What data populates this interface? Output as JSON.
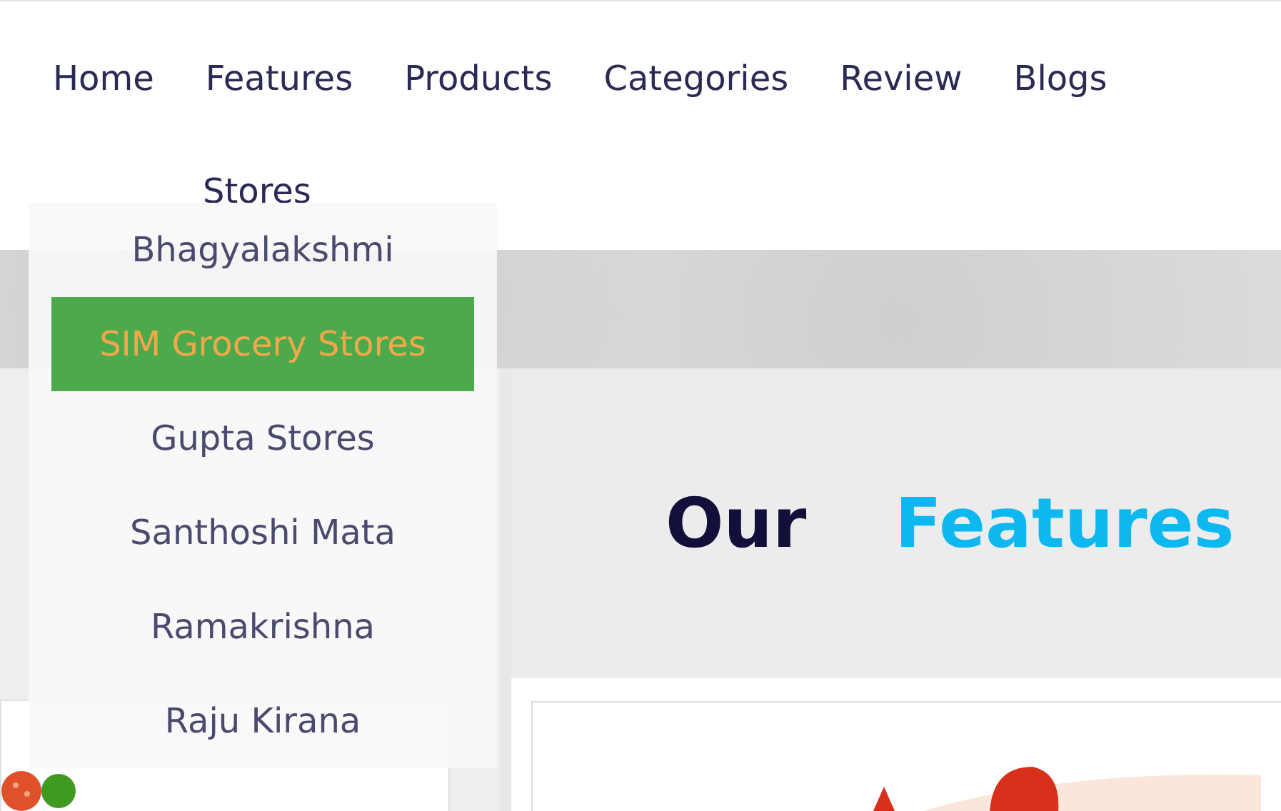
{
  "nav": {
    "items": [
      {
        "label": "Home"
      },
      {
        "label": "Features"
      },
      {
        "label": "Products"
      },
      {
        "label": "Categories"
      },
      {
        "label": "Review"
      },
      {
        "label": "Blogs"
      },
      {
        "label": "Stores"
      }
    ]
  },
  "stores_menu": {
    "items": [
      {
        "label": "Bhagyalakshmi",
        "selected": false
      },
      {
        "label": "SIM Grocery Stores",
        "selected": true
      },
      {
        "label": "Gupta Stores",
        "selected": false
      },
      {
        "label": "Santhoshi Mata",
        "selected": false
      },
      {
        "label": "Ramakrishna",
        "selected": false
      },
      {
        "label": "Raju Kirana",
        "selected": false
      }
    ]
  },
  "heading": {
    "parts": [
      {
        "text": "Our",
        "kind": "dark"
      },
      {
        "text": "Features",
        "kind": "accent"
      }
    ]
  }
}
